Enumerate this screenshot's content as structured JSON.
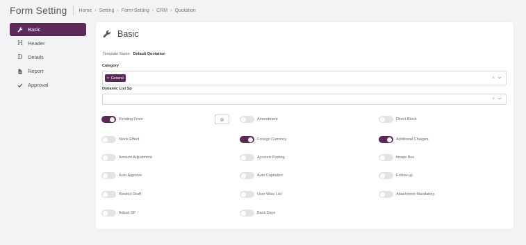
{
  "header": {
    "title": "Form Setting",
    "breadcrumb": [
      "Home",
      "Setting",
      "Form Setting",
      "CRM",
      "Quotation"
    ]
  },
  "sidebar": {
    "items": [
      {
        "label": "Basic",
        "icon": "wrench-icon",
        "active": true
      },
      {
        "label": "Header",
        "icon": "heading-icon",
        "active": false
      },
      {
        "label": "Details",
        "icon": "d-icon",
        "active": false
      },
      {
        "label": "Report",
        "icon": "file-icon",
        "active": false
      },
      {
        "label": "Approval",
        "icon": "check-icon",
        "active": false
      }
    ]
  },
  "panel": {
    "title": "Basic",
    "template_label": "Template Name:",
    "template_value": "Default Quotation",
    "category": {
      "label": "Category",
      "chips": [
        "General"
      ],
      "clear": "×"
    },
    "dynamic_list": {
      "label": "Dynamic List Sp",
      "value": "",
      "clear": "×"
    },
    "toggles": [
      {
        "label": "Pending From",
        "on": true
      },
      {
        "label": "Amendment",
        "on": false
      },
      {
        "label": "Direct Block",
        "on": false
      },
      {
        "label": "Stock Effect",
        "on": false
      },
      {
        "label": "Foreign Currency",
        "on": true
      },
      {
        "label": "Additional Charges",
        "on": true
      },
      {
        "label": "Amount Adjustment",
        "on": false
      },
      {
        "label": "Account Posting",
        "on": false
      },
      {
        "label": "Image Box",
        "on": false
      },
      {
        "label": "Auto Approve",
        "on": false
      },
      {
        "label": "Auto Capitalize",
        "on": false
      },
      {
        "label": "Follow-up",
        "on": false
      },
      {
        "label": "Restrict Draft",
        "on": false
      },
      {
        "label": "User Wise List",
        "on": false
      },
      {
        "label": "Attachment Mandatory",
        "on": false
      },
      {
        "label": "Adjust SP",
        "on": false
      },
      {
        "label": "Back Days",
        "on": false
      }
    ]
  },
  "colors": {
    "accent": "#5b2a56",
    "toggle_off": "#e3e3e3",
    "background": "#f3f3f5"
  }
}
